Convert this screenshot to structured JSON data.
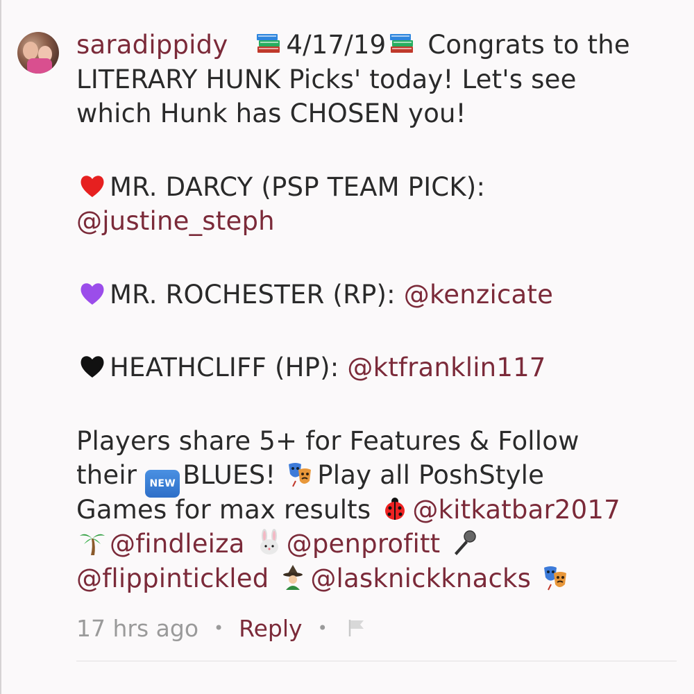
{
  "comment": {
    "username": "saradippidy",
    "intro_date": "4/17/19",
    "intro_text": "Congrats to the",
    "line2": "LITERARY HUNK Picks' today! Let's see",
    "line3": "which Hunk has CHOSEN you!",
    "pick1_label": "MR. DARCY (PSP TEAM PICK):",
    "pick1_mention": "@justine_steph",
    "pick2_label": "MR. ROCHESTER (RP):",
    "pick2_mention": "@kenzicate",
    "pick3_label": "HEATHCLIFF (HP):",
    "pick3_mention": "@ktfranklin117",
    "players_line1": "Players share 5+ for Features & Follow",
    "players_line2_a": "their",
    "new_badge": "NEW",
    "players_line2_b": "BLUES!",
    "players_line2_c": "Play all PoshStyle",
    "players_line3_a": "Games for max results",
    "mention_kitkat": "@kitkatbar2017",
    "mention_findleiza": "@findleiza",
    "mention_penprofitt": "@penprofitt",
    "mention_flippin": "@flippintickled",
    "mention_lasknick": "@lasknickknacks"
  },
  "footer": {
    "time_ago": "17 hrs ago",
    "separator": "•",
    "reply_label": "Reply"
  },
  "colors": {
    "mention": "#7b2a39",
    "muted": "#9a9a9a",
    "background": "#fbf9fa"
  },
  "icons": [
    "books-icon",
    "red-heart-icon",
    "purple-heart-icon",
    "black-heart-icon",
    "new-badge-icon",
    "theater-masks-icon",
    "ladybug-icon",
    "palm-tree-icon",
    "bunny-face-icon",
    "microphone-icon",
    "witch-icon",
    "flag-icon"
  ]
}
